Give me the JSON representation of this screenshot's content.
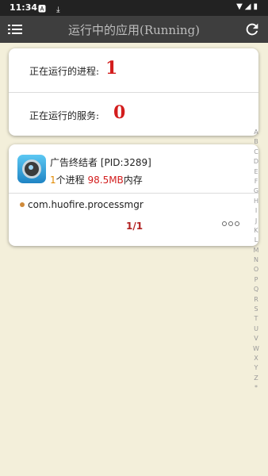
{
  "status_bar": {
    "time": "11:34",
    "left_icons": "🅰 ⤓",
    "right_icons": "▼◢▮"
  },
  "toolbar": {
    "title": "运行中的应用(Running)"
  },
  "summary": {
    "process_label": "正在运行的进程:",
    "process_count": "1",
    "service_label": "正在运行的服务:",
    "service_count": "0"
  },
  "app": {
    "name": "广告终结者 [PID:3289]",
    "proc_count": "1",
    "proc_text": "个进程",
    "memory": "98.5MB",
    "memory_unit": "内存",
    "process_name": "com.huofire.processmgr"
  },
  "pager": {
    "label": "1/1"
  },
  "alphabet": [
    "A",
    "B",
    "C",
    "D",
    "E",
    "F",
    "G",
    "H",
    "I",
    "J",
    "K",
    "L",
    "M",
    "N",
    "O",
    "P",
    "Q",
    "R",
    "S",
    "T",
    "U",
    "V",
    "W",
    "X",
    "Y",
    "Z",
    "*"
  ],
  "colors": {
    "accent_red": "#d31d1d",
    "toolbar_bg": "#3e3e3e",
    "background": "#f3efda"
  }
}
